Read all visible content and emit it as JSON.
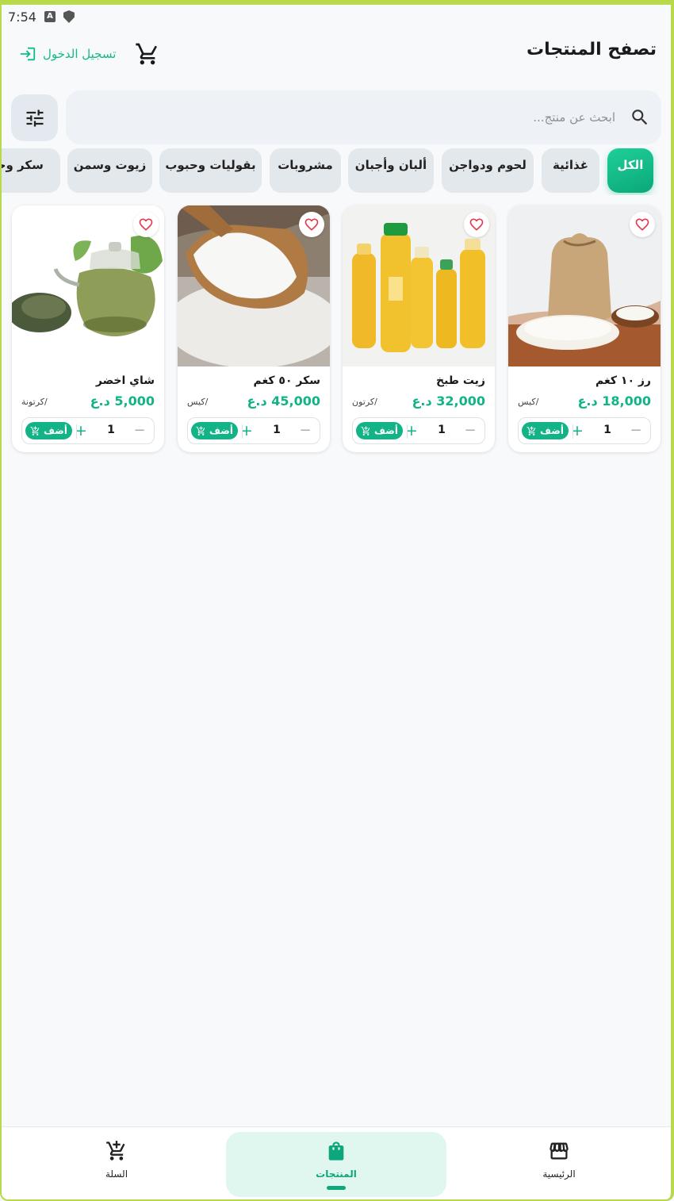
{
  "status_bar": {
    "time": "7:54"
  },
  "header": {
    "title": "تصفح المنتجات",
    "login_label": "تسجيل الدخول"
  },
  "search": {
    "placeholder": "ابحث عن منتج...",
    "value": ""
  },
  "categories": [
    {
      "label": "الكل",
      "active": true
    },
    {
      "label": "غذائية",
      "active": false
    },
    {
      "label": "لحوم ودواجن",
      "active": false
    },
    {
      "label": "ألبان وأجبان",
      "active": false
    },
    {
      "label": "مشروبات",
      "active": false
    },
    {
      "label": "بقوليات وحبوب",
      "active": false
    },
    {
      "label": "زيوت وسمن",
      "active": false
    },
    {
      "label": "سكر وحلو",
      "active": false
    }
  ],
  "products": [
    {
      "name": "رز ١٠ كغم",
      "price": "18,000 د.ع",
      "unit": "/كيس",
      "quantity": "1",
      "add_label": "أضف",
      "image": "rice-sack"
    },
    {
      "name": "زيت طبخ",
      "price": "32,000 د.ع",
      "unit": "/كرتون",
      "quantity": "1",
      "add_label": "أضف",
      "image": "cooking-oil-bottles"
    },
    {
      "name": "سكر ٥٠ كغم",
      "price": "45,000 د.ع",
      "unit": "/كيس",
      "quantity": "1",
      "add_label": "أضف",
      "image": "sugar-spoon"
    },
    {
      "name": "شاي اخضر",
      "price": "5,000 د.ع",
      "unit": "/كرتونة",
      "quantity": "1",
      "add_label": "أضف",
      "image": "green-tea-pot"
    }
  ],
  "bottom_nav": [
    {
      "label": "الرئيسية",
      "icon": "store-icon",
      "active": false
    },
    {
      "label": "المنتجات",
      "icon": "shopping-bag-icon",
      "active": true
    },
    {
      "label": "السلة",
      "icon": "cart-icon",
      "active": false
    }
  ],
  "colors": {
    "accent": "#12b487",
    "accent_light": "#e0f7f0",
    "favorite": "#e53950"
  }
}
